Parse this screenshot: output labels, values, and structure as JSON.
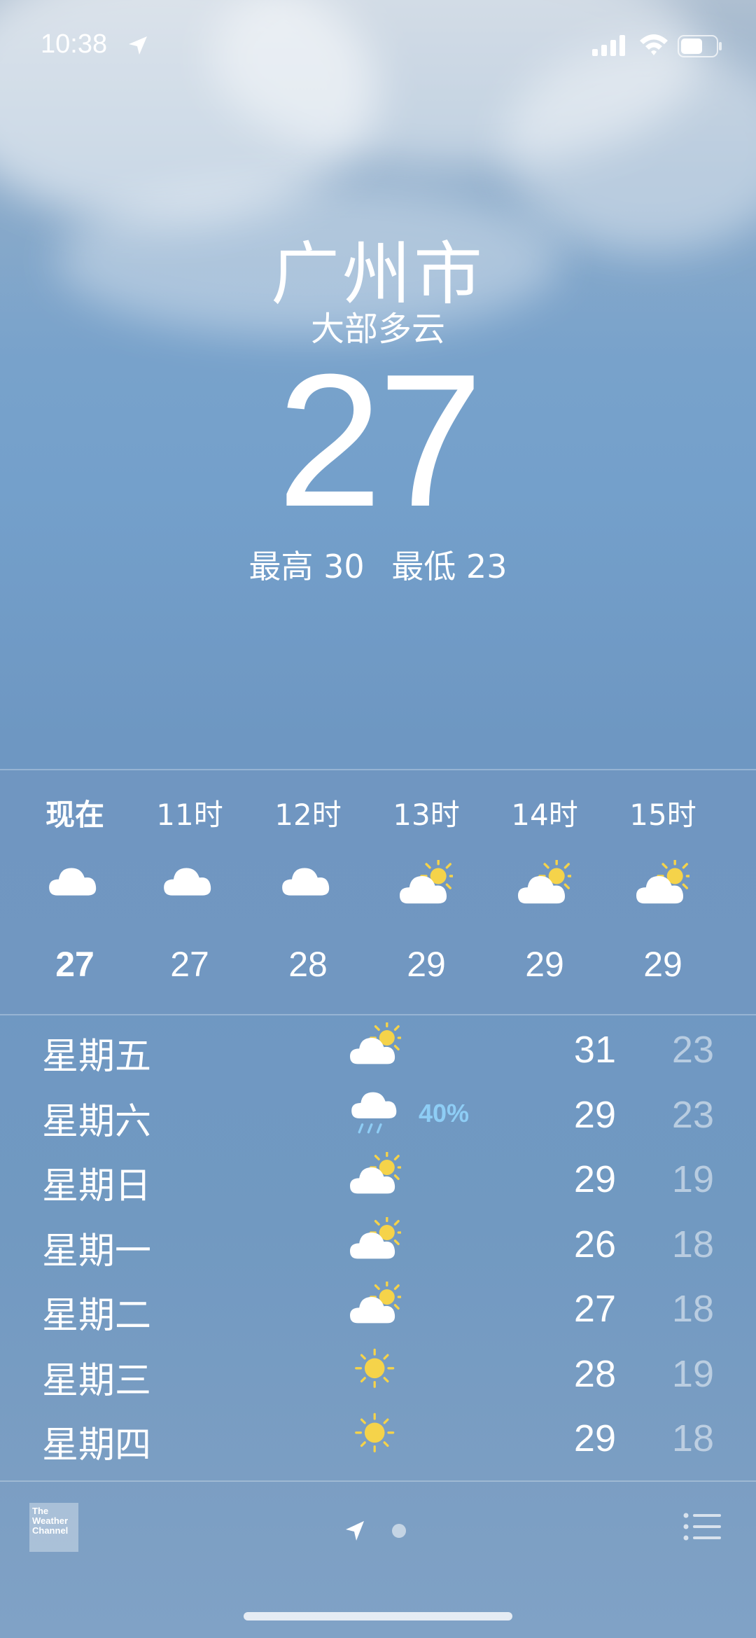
{
  "status_bar": {
    "time": "10:38"
  },
  "current": {
    "city": "广州市",
    "condition": "大部多云",
    "temperature": "27",
    "high": "最高 30",
    "low": "最低 23"
  },
  "hourly": [
    {
      "label": "现在",
      "icon": "cloud-icon",
      "temp": "27"
    },
    {
      "label": "11时",
      "icon": "cloud-icon",
      "temp": "27"
    },
    {
      "label": "12时",
      "icon": "cloud-icon",
      "temp": "28"
    },
    {
      "label": "13时",
      "icon": "partly-sunny-icon",
      "temp": "29"
    },
    {
      "label": "14时",
      "icon": "partly-sunny-icon",
      "temp": "29"
    },
    {
      "label": "15时",
      "icon": "partly-sunny-icon",
      "temp": "29"
    }
  ],
  "daily": [
    {
      "day": "星期五",
      "icon": "partly-sunny-icon",
      "precip": "",
      "high": "31",
      "low": "23"
    },
    {
      "day": "星期六",
      "icon": "rain-icon",
      "precip": "40%",
      "high": "29",
      "low": "23"
    },
    {
      "day": "星期日",
      "icon": "partly-sunny-icon",
      "precip": "",
      "high": "29",
      "low": "19"
    },
    {
      "day": "星期一",
      "icon": "partly-sunny-icon",
      "precip": "",
      "high": "26",
      "low": "18"
    },
    {
      "day": "星期二",
      "icon": "partly-sunny-icon",
      "precip": "",
      "high": "27",
      "low": "18"
    },
    {
      "day": "星期三",
      "icon": "sun-icon",
      "precip": "",
      "high": "28",
      "low": "19"
    },
    {
      "day": "星期四",
      "icon": "sun-icon",
      "precip": "",
      "high": "29",
      "low": "18"
    }
  ],
  "footer": {
    "logo_text": "The Weather Channel"
  },
  "colors": {
    "sun": "#f5d34a",
    "precip": "#8ecdf5"
  }
}
